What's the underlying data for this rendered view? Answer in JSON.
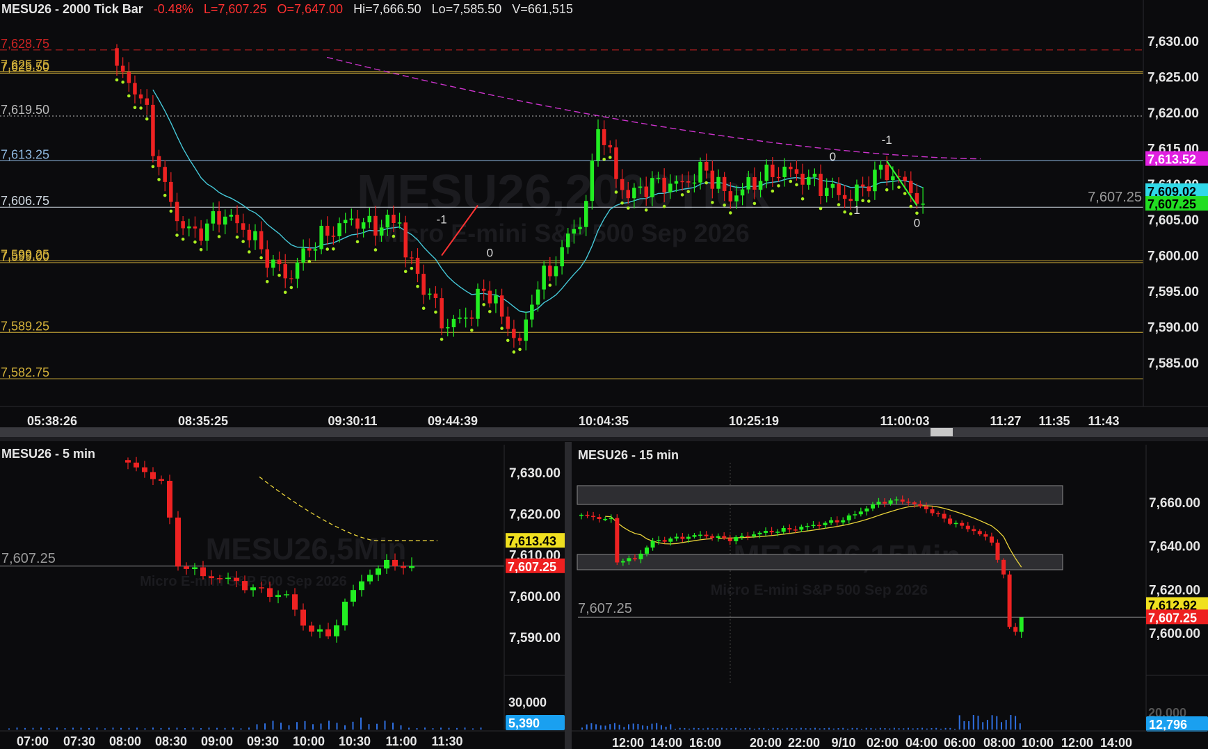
{
  "colors": {
    "bg": "#0b0b0d",
    "up": "#22ee22",
    "down": "#ee2222",
    "dot_green": "#aaee22",
    "cyan_ma": "#45c8d8",
    "magenta_ma": "#cc33cc",
    "yellow_ma": "#e8d23a",
    "red_level": "#cc2222",
    "gold_level": "#d4b23a",
    "axis_text": "#e6e6e6",
    "zone_fill": "#2e2e32",
    "volume": "#2f6fe0"
  },
  "main": {
    "header": {
      "symbol": "MESU26 - 2000 Tick Bar",
      "change": "-0.48%",
      "last": "L=7,607.25",
      "open": "O=7,647.00",
      "high": "Hi=7,666.50",
      "low": "Lo=7,585.50",
      "volume": "V=661,515"
    },
    "watermark": {
      "big": "MESU26,2000Tick",
      "small": "Micro E-mini S&P 500 Sep 2026"
    },
    "price_axis": [
      "7,630.00",
      "7,625.00",
      "7,620.00",
      "7,615.00",
      "7,610.00",
      "7,605.00",
      "7,600.00",
      "7,595.00",
      "7,590.00",
      "7,585.00"
    ],
    "price_ticks": [
      7630,
      7625,
      7620,
      7615,
      7610,
      7605,
      7600,
      7595,
      7590,
      7585
    ],
    "badges": [
      {
        "text": "7,613.52",
        "value": 7613.52,
        "bg": "#e020e0",
        "fg": "#ffffff"
      },
      {
        "text": "7,609.02",
        "value": 7609.02,
        "bg": "#30d8e8",
        "fg": "#000000"
      },
      {
        "text": "7,607.25",
        "value": 7607.25,
        "bg": "#22dd22",
        "fg": "#000000"
      }
    ],
    "last_label": "7,607.25",
    "levels": [
      {
        "text": "7,628.75",
        "value": 7628.75,
        "color": "#cc2222",
        "style": "dashed"
      },
      {
        "text": "7,625.75",
        "value": 7625.75,
        "color": "#d4b23a",
        "style": "solid"
      },
      {
        "text": "7,625.50",
        "value": 7625.5,
        "color": "#d4b23a",
        "style": "solid"
      },
      {
        "text": "7,619.50",
        "value": 7619.5,
        "color": "#bbbbbb",
        "style": "dotted"
      },
      {
        "text": "7,613.25",
        "value": 7613.25,
        "color": "#8fb9e0",
        "style": "solid"
      },
      {
        "text": "7,606.75",
        "value": 7606.75,
        "color": "#cfd8e0",
        "style": "solid"
      },
      {
        "text": "7,599.25",
        "value": 7599.25,
        "color": "#d4b23a",
        "style": "solid"
      },
      {
        "text": "7,599.00",
        "value": 7599.0,
        "color": "#d4b23a",
        "style": "solid"
      },
      {
        "text": "7,589.25",
        "value": 7589.25,
        "color": "#d4b23a",
        "style": "solid"
      },
      {
        "text": "7,582.75",
        "value": 7582.75,
        "color": "#d4b23a",
        "style": "solid"
      }
    ],
    "time_axis": [
      "05:38:26",
      "08:35:25",
      "09:30:11",
      "09:44:39",
      "10:04:35",
      "10:25:19",
      "11:00:03",
      "11:27",
      "11:35",
      "11:43"
    ],
    "swing_labels": [
      {
        "text": "-1",
        "value": 7604.5,
        "bar": 54
      },
      {
        "text": "0",
        "value": 7599.8,
        "bar": 62
      },
      {
        "text": "0",
        "value": 7613.3,
        "bar": 119
      },
      {
        "text": "1",
        "value": 7605.8,
        "bar": 123
      },
      {
        "text": "-1",
        "value": 7615.6,
        "bar": 128
      },
      {
        "text": "0",
        "value": 7604.0,
        "bar": 133
      }
    ]
  },
  "p5": {
    "header": "MESU26 - 5 min",
    "watermark": {
      "big": "MESU26,5Min",
      "small": "Micro E-mini S&P 500 Sep 2026"
    },
    "price_axis": [
      "7,630.00",
      "7,620.00",
      "7,610.00",
      "7,600.00",
      "7,590.00"
    ],
    "price_ticks": [
      7630,
      7620,
      7610,
      7600,
      7590
    ],
    "badges": [
      {
        "text": "7,613.43",
        "value": 7613.43,
        "bg": "#f0e020",
        "fg": "#000000"
      },
      {
        "text": "7,607.25",
        "value": 7607.25,
        "bg": "#ee2020",
        "fg": "#ffffff"
      }
    ],
    "last_label": "7,607.25",
    "volume_axis": "30,000",
    "volume_badge": "5,390",
    "time_axis": [
      "07:00",
      "07:30",
      "08:00",
      "08:30",
      "09:00",
      "09:30",
      "10:00",
      "10:30",
      "11:00",
      "11:30"
    ]
  },
  "p15": {
    "header": "MESU26 - 15 min",
    "watermark": {
      "big": "MESU26,15Min",
      "small": "Micro E-mini S&P 500 Sep 2026"
    },
    "price_axis": [
      "7,660.00",
      "7,640.00",
      "7,620.00",
      "7,600.00"
    ],
    "price_ticks": [
      7660,
      7640,
      7620,
      7600
    ],
    "badges": [
      {
        "text": "7,612.92",
        "value": 7612.92,
        "bg": "#f0e020",
        "fg": "#000000"
      },
      {
        "text": "7,607.25",
        "value": 7607.25,
        "bg": "#ee2020",
        "fg": "#ffffff"
      }
    ],
    "last_label": "7,607.25",
    "volume_axis": "20,000",
    "volume_badge": "12,796",
    "time_axis": [
      "12:00",
      "14:00",
      "16:00",
      "20:00",
      "22:00",
      "9/10",
      "02:00",
      "04:00",
      "06:00",
      "08:00",
      "10:00",
      "12:00",
      "14:00"
    ]
  }
}
